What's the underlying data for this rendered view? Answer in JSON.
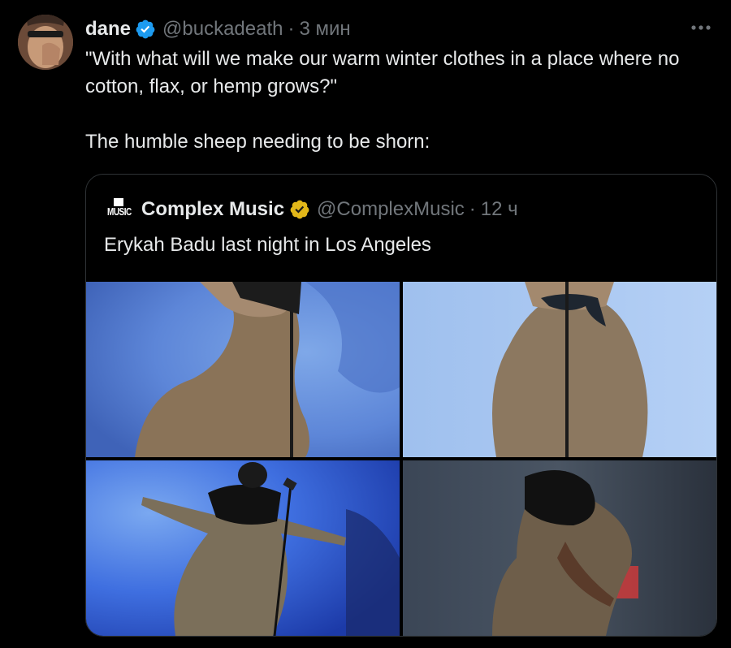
{
  "tweet": {
    "author": {
      "display_name": "dane",
      "handle": "@buckadeath",
      "verified": true
    },
    "separator": "·",
    "time": "3 мин",
    "text": [
      "\"With what will we make our warm winter clothes in a place where no cotton, flax, or hemp grows?\"",
      "The humble sheep needing to be shorn:"
    ],
    "more_icon": "more-horizontal-icon"
  },
  "quoted": {
    "logo_text": "MUSIC",
    "author": {
      "display_name": "Complex Music",
      "handle": "@ComplexMusic",
      "verified_type": "gold"
    },
    "separator": "·",
    "time": "12 ч",
    "text": "Erykah Badu last night in Los Angeles",
    "media_count": 4
  },
  "colors": {
    "background": "#000000",
    "text_primary": "#e7e9ea",
    "text_secondary": "#71767b",
    "border": "#2f3336",
    "verified_blue": "#1d9bf0",
    "verified_gold": "#e2b719"
  }
}
